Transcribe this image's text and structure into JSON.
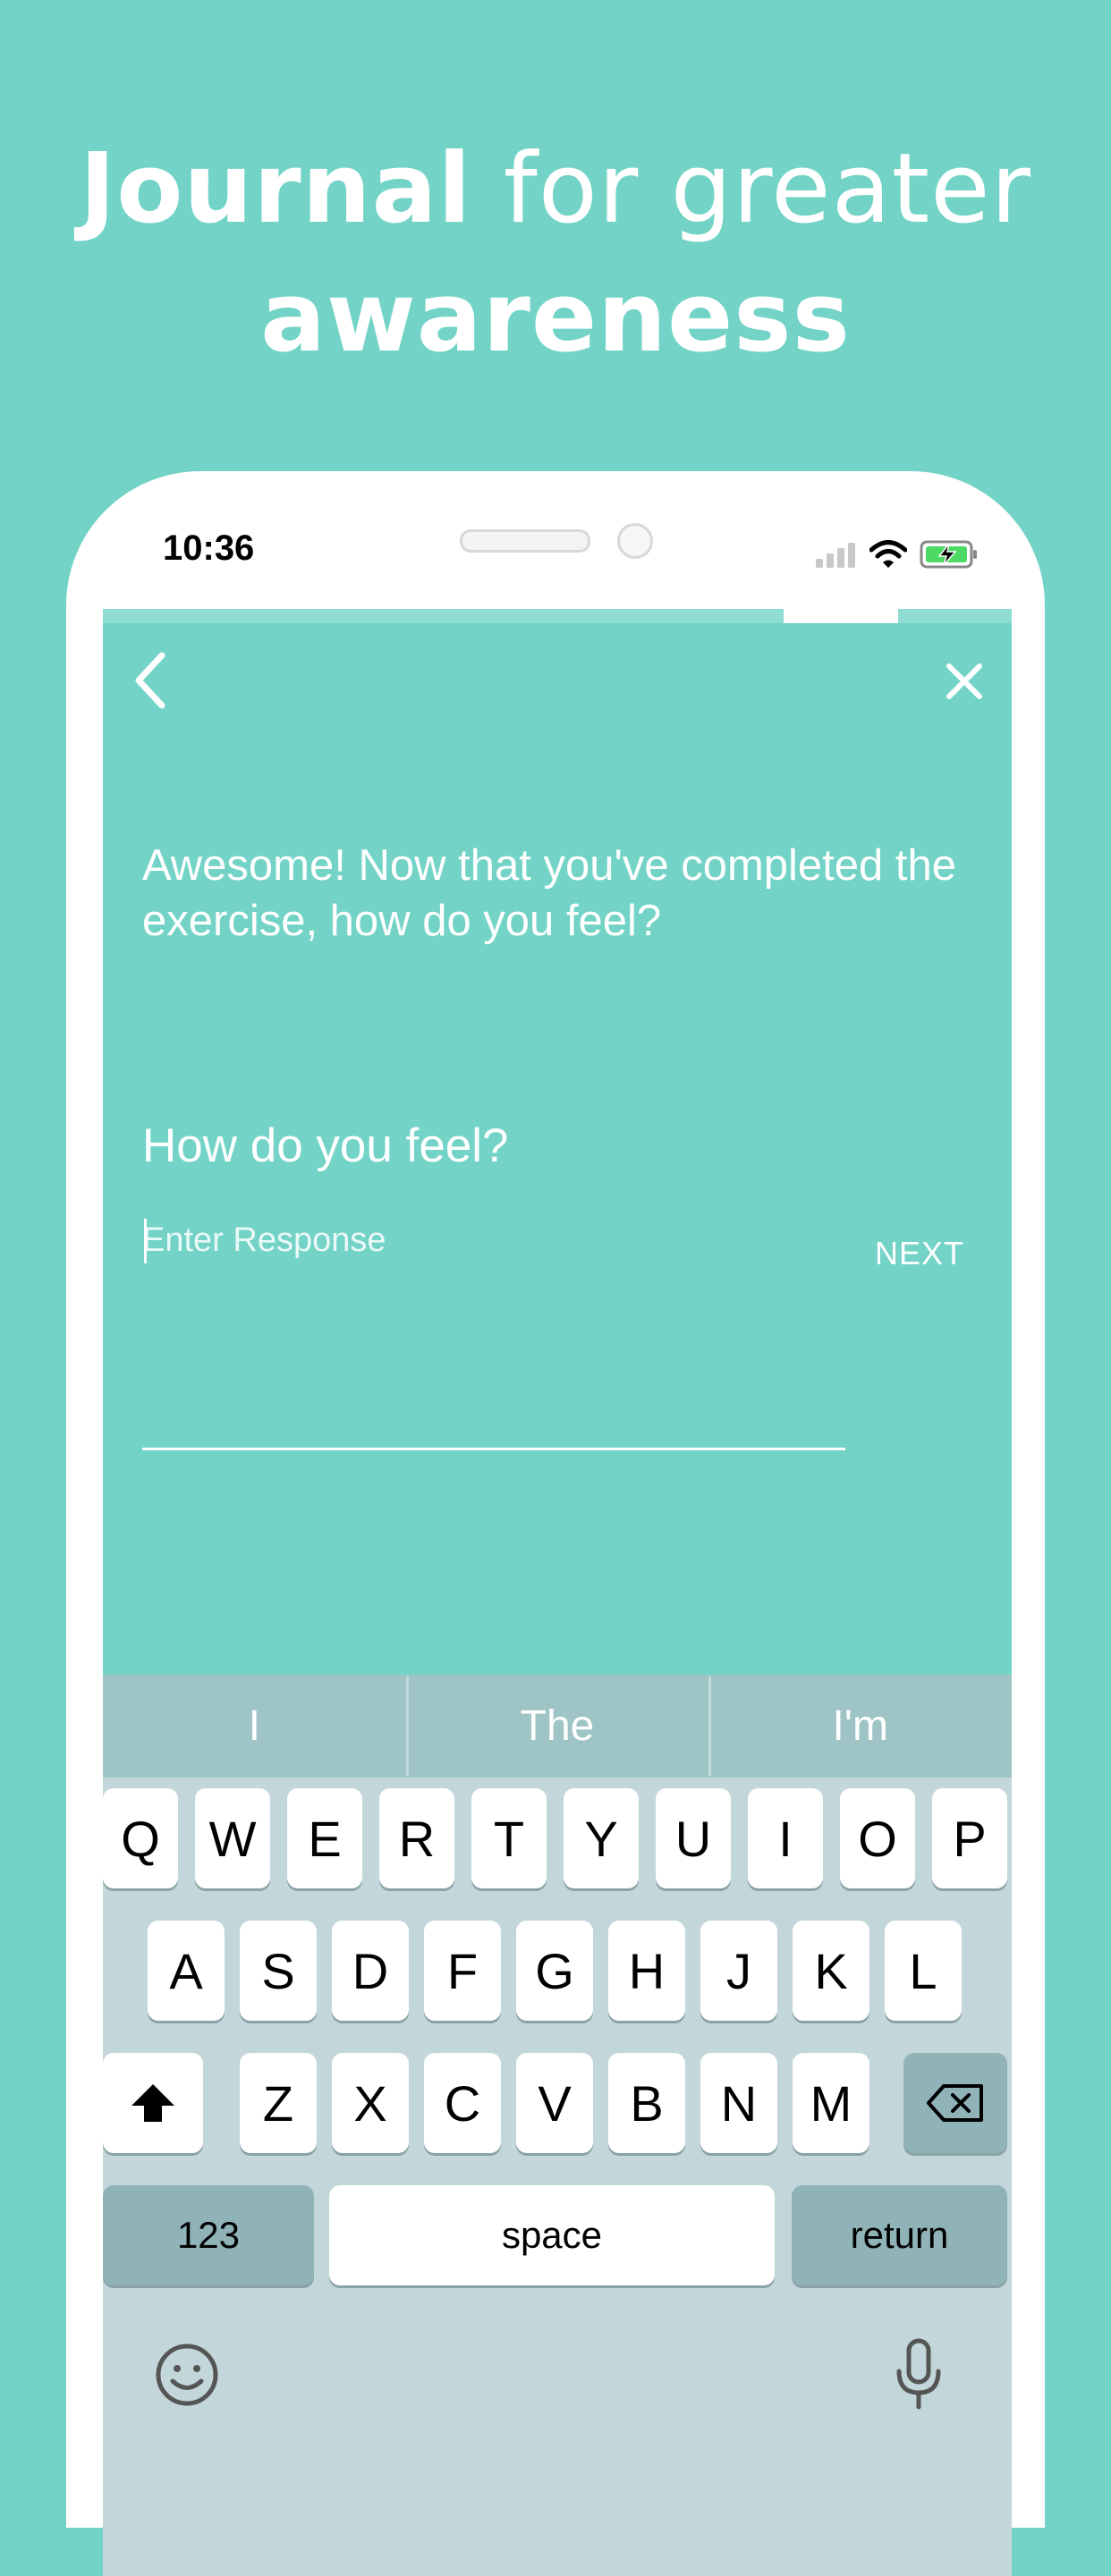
{
  "headline": {
    "bold1": "Journal",
    "light": " for greater",
    "bold2": "awareness"
  },
  "status": {
    "time": "10:36"
  },
  "screen": {
    "progress": 0.87,
    "prompt": "Awesome! Now that you've completed the exercise, how do you feel?",
    "question": "How do you feel?",
    "response_placeholder": "Enter Response",
    "next_label": "NEXT"
  },
  "suggestions": [
    "I",
    "The",
    "I'm"
  ],
  "keyboard": {
    "row1": [
      "Q",
      "W",
      "E",
      "R",
      "T",
      "Y",
      "U",
      "I",
      "O",
      "P"
    ],
    "row2": [
      "A",
      "S",
      "D",
      "F",
      "G",
      "H",
      "J",
      "K",
      "L"
    ],
    "row3": [
      "Z",
      "X",
      "C",
      "V",
      "B",
      "N",
      "M"
    ],
    "numbers_label": "123",
    "space_label": "space",
    "return_label": "return"
  },
  "colors": {
    "background": "#72d3c6",
    "keyboard": "#c3d7da",
    "suggestion_bar": "#9fc4c6"
  }
}
